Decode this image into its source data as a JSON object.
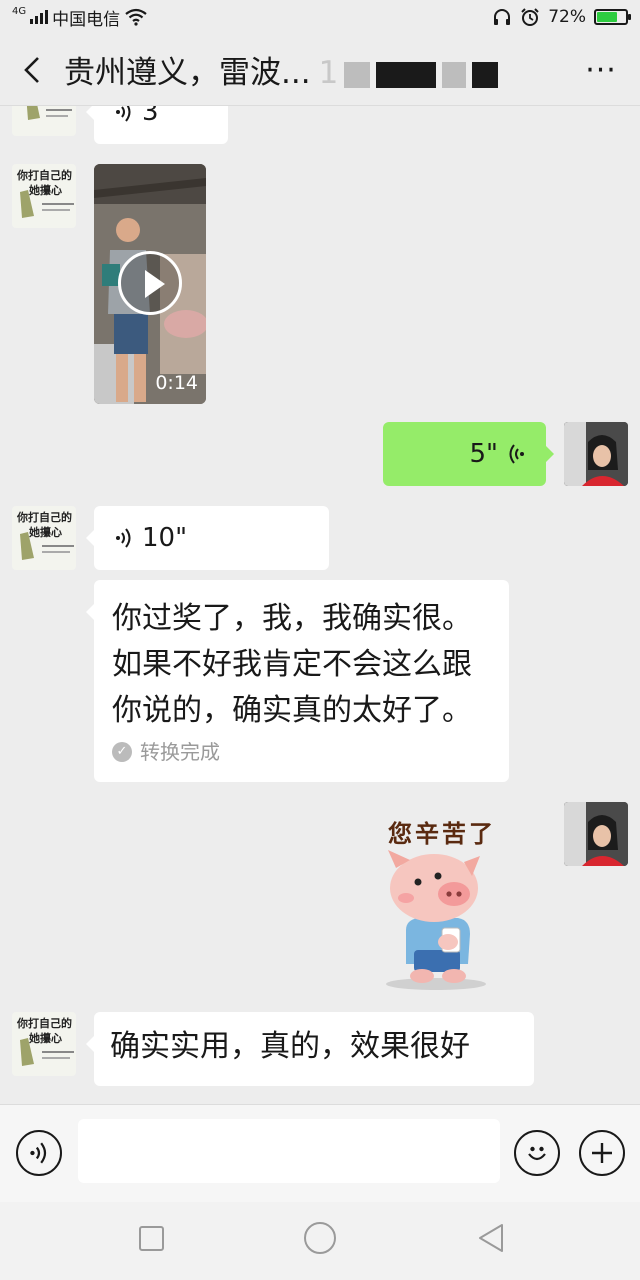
{
  "status_bar": {
    "network": "4G",
    "carrier": "中国电信",
    "battery_percent": "72%",
    "battery_level": 0.72
  },
  "header": {
    "title": "贵州遵义，雷波...",
    "title_redacted_tail": "1",
    "back_icon": "chevron-left-icon",
    "more_icon": "more-dots-icon",
    "more_label": "···"
  },
  "messages": [
    {
      "type": "voice",
      "side": "left",
      "duration": "3"
    },
    {
      "type": "video",
      "side": "left",
      "duration": "0:14"
    },
    {
      "type": "voice",
      "side": "right",
      "duration": "5\""
    },
    {
      "type": "voice",
      "side": "left",
      "duration": "10\""
    },
    {
      "type": "voice_text",
      "side": "left",
      "lines": [
        "你过奖了，我，我确实很。",
        "如果不好我肯定不会这么跟",
        "你说的，确实真的太好了。"
      ],
      "status": "转换完成"
    },
    {
      "type": "sticker",
      "side": "right",
      "text": "您辛苦了"
    },
    {
      "type": "text",
      "side": "left",
      "text": "确实实用，真的，效果很好"
    }
  ],
  "avatars": {
    "left_text": [
      "你打自己的",
      "她攥心"
    ]
  },
  "input_bar": {
    "voice_icon": "voice-input-icon",
    "emoji_icon": "emoji-icon",
    "plus_icon": "plus-icon"
  },
  "colors": {
    "background": "#ededed",
    "bubble_sent": "#95ec69",
    "bubble_received": "#ffffff",
    "battery": "#2ecc40"
  }
}
